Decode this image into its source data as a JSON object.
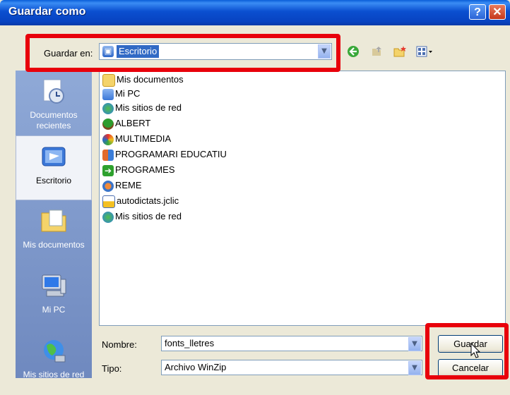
{
  "window": {
    "title": "Guardar como"
  },
  "titlebar_buttons": {
    "help": "?",
    "close": "✕"
  },
  "save_in": {
    "label": "Guardar en:",
    "value": "Escritorio"
  },
  "places": [
    {
      "label": "Documentos recientes",
      "icon": "recent-documents-icon",
      "selected": false
    },
    {
      "label": "Escritorio",
      "icon": "desktop-icon",
      "selected": true
    },
    {
      "label": "Mis documentos",
      "icon": "my-documents-icon",
      "selected": false
    },
    {
      "label": "Mi PC",
      "icon": "my-computer-icon",
      "selected": false
    },
    {
      "label": "Mis sitios de red",
      "icon": "network-places-icon",
      "selected": false
    }
  ],
  "files": [
    {
      "name": "Mis documentos",
      "icon": "folder-icon"
    },
    {
      "name": "Mi PC",
      "icon": "computer-icon"
    },
    {
      "name": "Mis sitios de red",
      "icon": "network-icon"
    },
    {
      "name": "ALBERT",
      "icon": "tree-icon"
    },
    {
      "name": "MULTIMEDIA",
      "icon": "colorful-app-icon"
    },
    {
      "name": "PROGRAMARI EDUCATIU",
      "icon": "people-icon"
    },
    {
      "name": "PROGRAMES",
      "icon": "green-arrow-icon"
    },
    {
      "name": "REME",
      "icon": "gear-globe-icon"
    },
    {
      "name": "autodictats.jclic",
      "icon": "jclic-file-icon"
    },
    {
      "name": "Mis sitios de red",
      "icon": "network-shortcut-icon"
    }
  ],
  "filename": {
    "label": "Nombre:",
    "value": "fonts_lletres"
  },
  "filetype": {
    "label": "Tipo:",
    "value": "Archivo WinZip"
  },
  "buttons": {
    "save": "Guardar",
    "cancel": "Cancelar"
  },
  "colors": {
    "titlebar": "#0a4fd0",
    "highlight": "#e8000b",
    "places_bar": "#7c98c8",
    "selection": "#316ac5"
  }
}
